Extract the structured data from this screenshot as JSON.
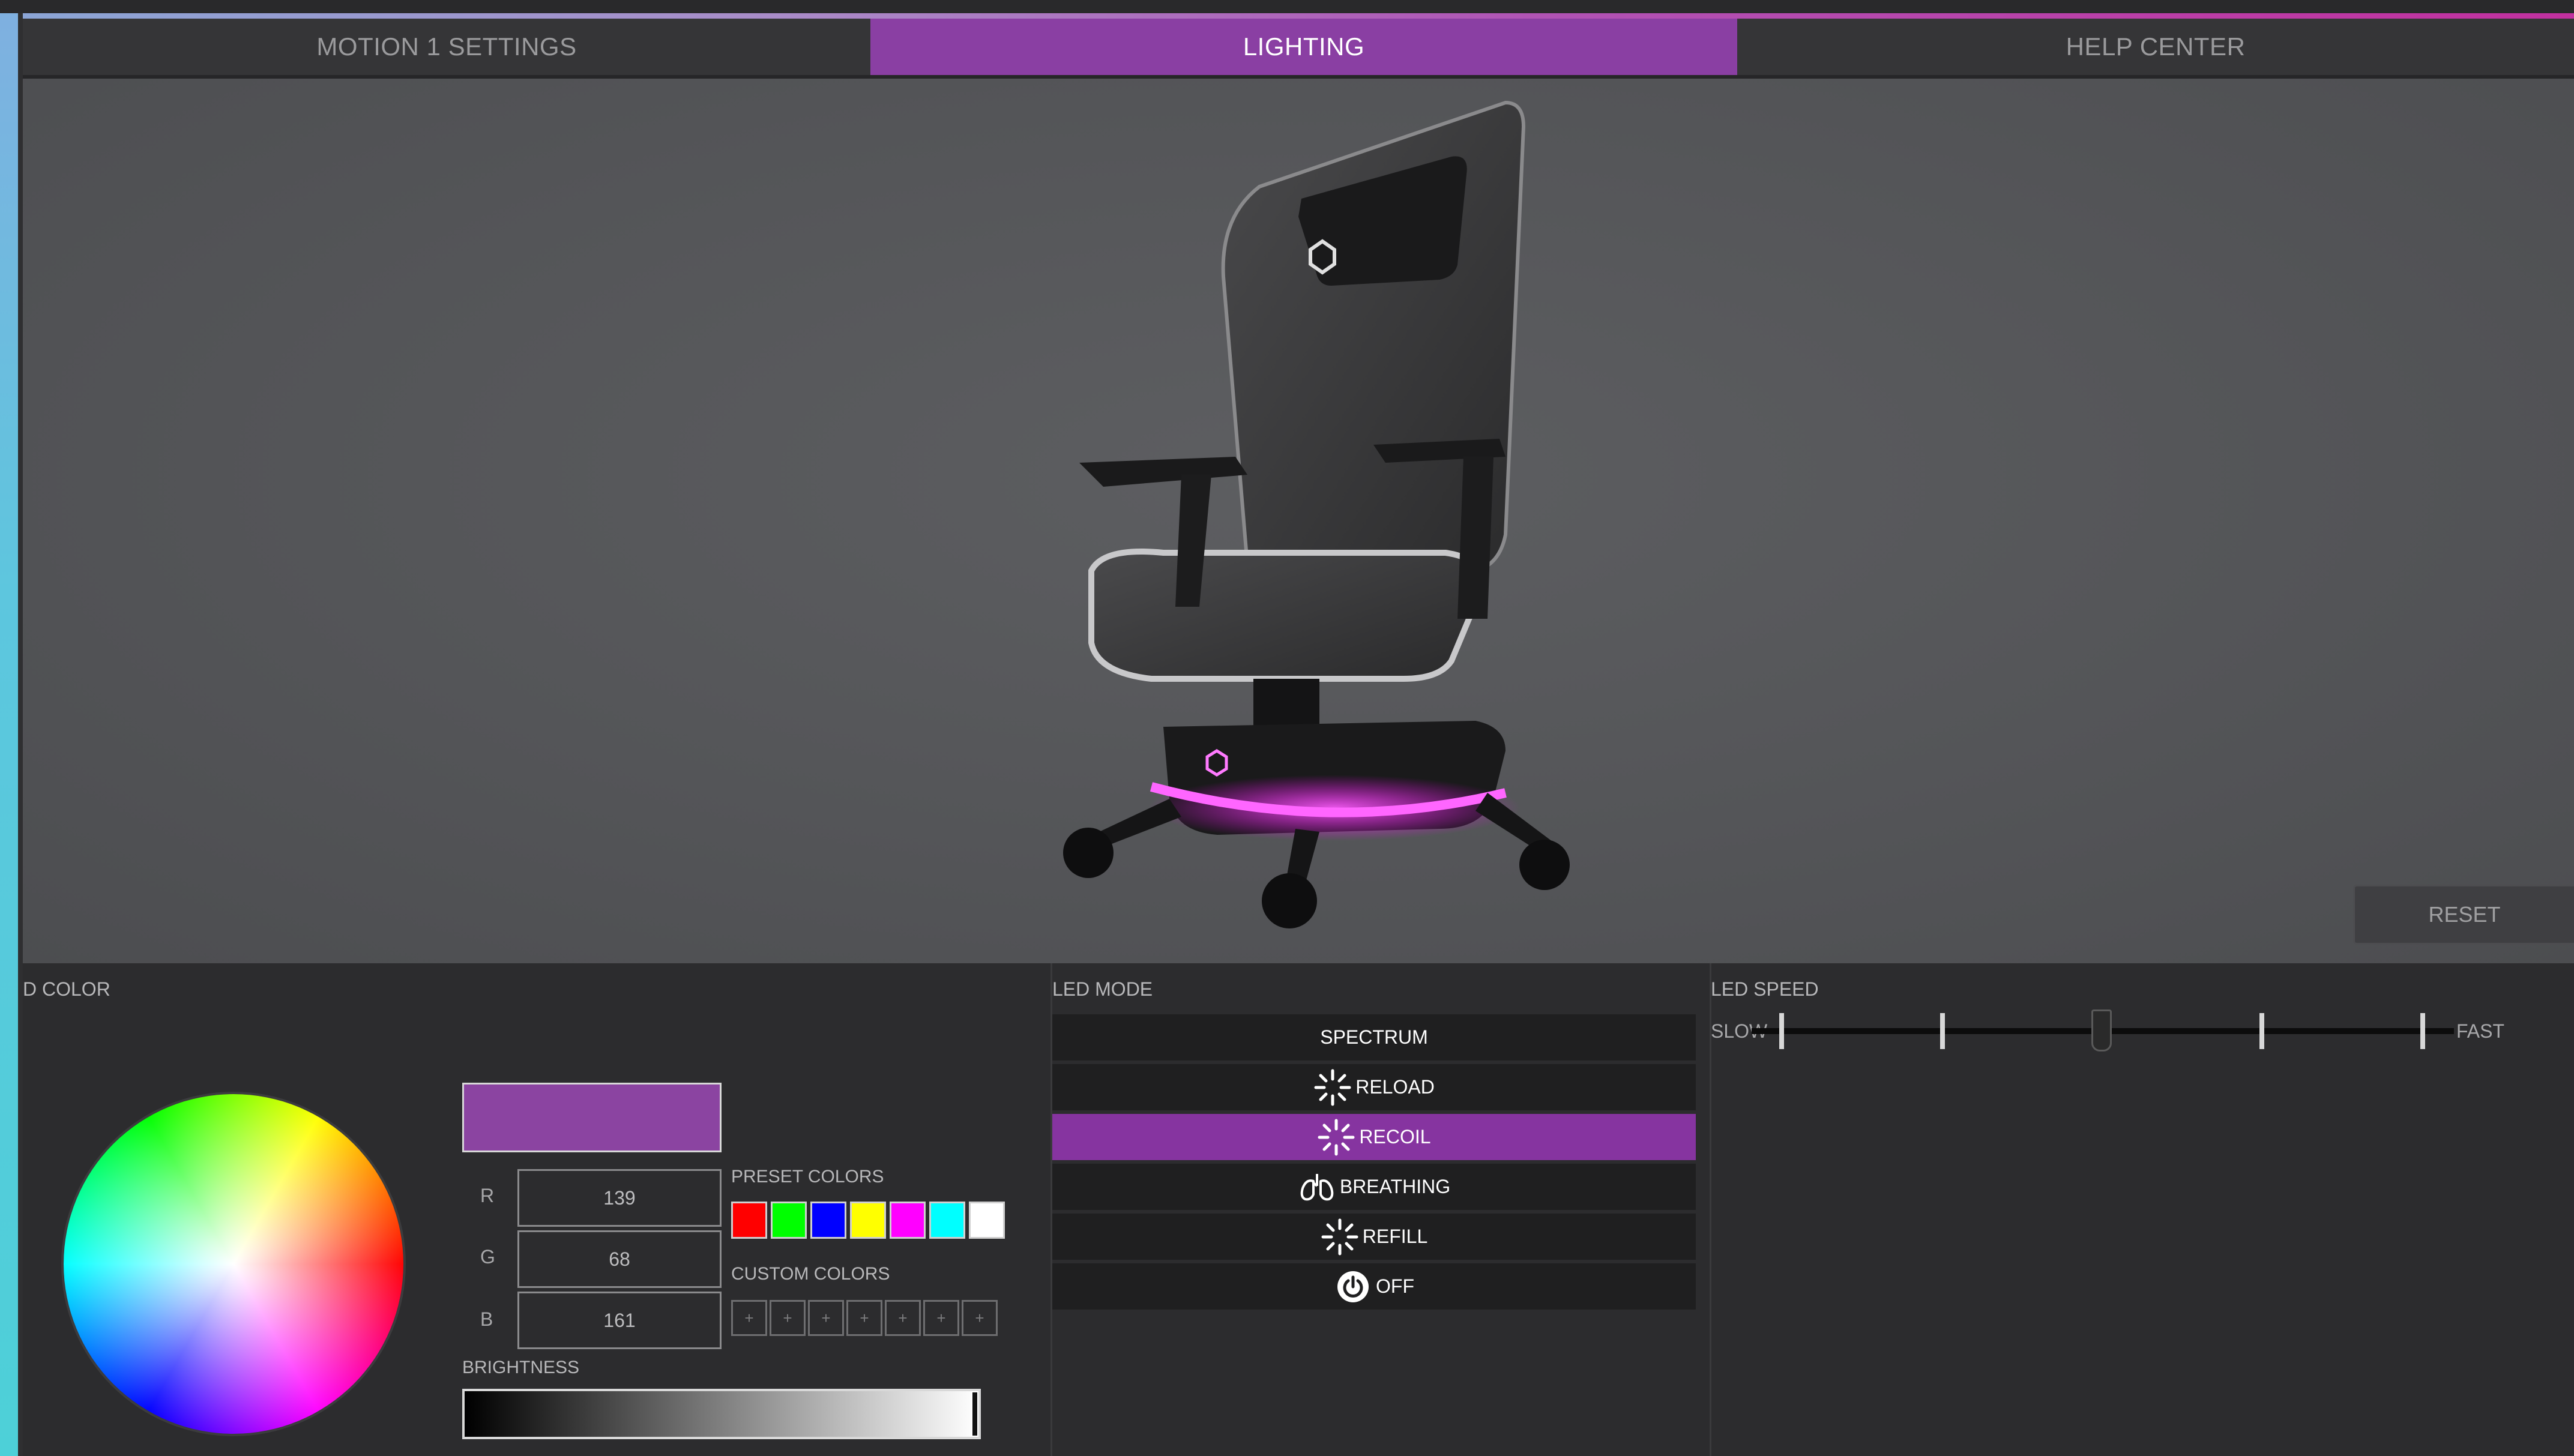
{
  "tabs": [
    {
      "label": "MOTION 1 SETTINGS",
      "active": false
    },
    {
      "label": "LIGHTING",
      "active": true
    },
    {
      "label": "HELP CENTER",
      "active": false
    }
  ],
  "viewport": {
    "reset_label": "RESET"
  },
  "led_color": {
    "title": "D COLOR",
    "current_color": "#8B44A1",
    "r": "139",
    "g": "68",
    "b": "161",
    "r_label": "R",
    "g_label": "G",
    "b_label": "B",
    "preset_title": "PRESET COLORS",
    "presets": [
      "#ff0000",
      "#00ff00",
      "#0000ff",
      "#ffff00",
      "#ff00ff",
      "#00ffff",
      "#ffffff"
    ],
    "custom_title": "CUSTOM COLORS",
    "custom_slots": [
      "+",
      "+",
      "+",
      "+",
      "+",
      "+",
      "+"
    ],
    "brightness_title": "BRIGHTNESS",
    "brightness_level": 0.98
  },
  "led_mode": {
    "title": "LED MODE",
    "modes": [
      {
        "label": "SPECTRUM",
        "icon": "none"
      },
      {
        "label": "RELOAD",
        "icon": "burst-icon"
      },
      {
        "label": "RECOIL",
        "icon": "burst-icon"
      },
      {
        "label": "BREATHING",
        "icon": "lungs-icon"
      },
      {
        "label": "REFILL",
        "icon": "burst-icon"
      },
      {
        "label": "OFF",
        "icon": "power-icon"
      }
    ],
    "selected": "RECOIL"
  },
  "led_speed": {
    "title": "LED SPEED",
    "slow_label": "SLOW",
    "fast_label": "FAST",
    "steps": 5,
    "value": 3
  }
}
